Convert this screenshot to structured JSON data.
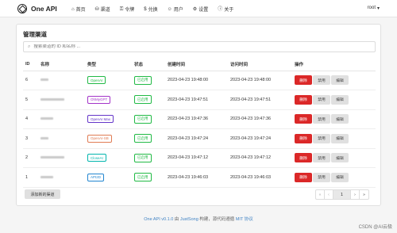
{
  "app": {
    "name": "One API"
  },
  "nav": [
    {
      "label": "首页",
      "icon": "home-icon",
      "glyph": "⌂"
    },
    {
      "label": "渠道",
      "icon": "sitemap-icon",
      "glyph": "⛁"
    },
    {
      "label": "令牌",
      "icon": "key-icon",
      "glyph": "⚿"
    },
    {
      "label": "兑换",
      "icon": "dollar-icon",
      "glyph": "$"
    },
    {
      "label": "用户",
      "icon": "user-icon",
      "glyph": "☺"
    },
    {
      "label": "设置",
      "icon": "gear-icon",
      "glyph": "⚙"
    },
    {
      "label": "关于",
      "icon": "info-icon",
      "glyph": "ⓘ"
    }
  ],
  "user": {
    "name": "root",
    "caret": "▾"
  },
  "page": {
    "title": "管理渠道"
  },
  "search": {
    "placeholder": "搜索渠道的 ID 和名称 ..."
  },
  "table": {
    "headers": [
      "ID",
      "名称",
      "类型",
      "状态",
      "创建时间",
      "访问时间",
      "操作"
    ],
    "rows": [
      {
        "id": "6",
        "type": "OpenAI",
        "type_color": "#21ba45",
        "status": "已启用",
        "created": "2023-04-23 19:48:00",
        "accessed": "2023-04-23 19:48:00",
        "name_w": 10
      },
      {
        "id": "5",
        "type": "OhMyGPT",
        "type_color": "#a333c8",
        "status": "已启用",
        "created": "2023-04-23 19:47:51",
        "accessed": "2023-04-23 19:47:51",
        "name_w": 30
      },
      {
        "id": "4",
        "type": "OpenAI Max",
        "type_color": "#6435c9",
        "status": "已启用",
        "created": "2023-04-23 19:47:36",
        "accessed": "2023-04-23 19:47:36",
        "name_w": 16
      },
      {
        "id": "3",
        "type": "OpenAI-SB",
        "type_color": "#e07b53",
        "status": "已启用",
        "created": "2023-04-23 19:47:24",
        "accessed": "2023-04-23 19:47:24",
        "name_w": 10
      },
      {
        "id": "2",
        "type": "CloseAI",
        "type_color": "#00b5ad",
        "status": "已启用",
        "created": "2023-04-23 19:47:12",
        "accessed": "2023-04-23 19:47:12",
        "name_w": 30
      },
      {
        "id": "1",
        "type": "API2D",
        "type_color": "#2185d0",
        "status": "已启用",
        "created": "2023-04-23 19:46:03",
        "accessed": "2023-04-23 19:46:03",
        "name_w": 16
      }
    ],
    "actions": {
      "delete": "删除",
      "disable": "禁用",
      "edit": "编辑"
    }
  },
  "add_button": "添加新的渠道",
  "pagination": {
    "first": "«",
    "prev": "‹",
    "current": "1",
    "next": "›",
    "last": "»"
  },
  "footer": {
    "app_version": "One API v0.1.0",
    "by": " 由 ",
    "author": "JustSong",
    "built": " 构建，源代码遵循 ",
    "license": "MIT 协议"
  },
  "watermark": "CSDN @AI云极"
}
